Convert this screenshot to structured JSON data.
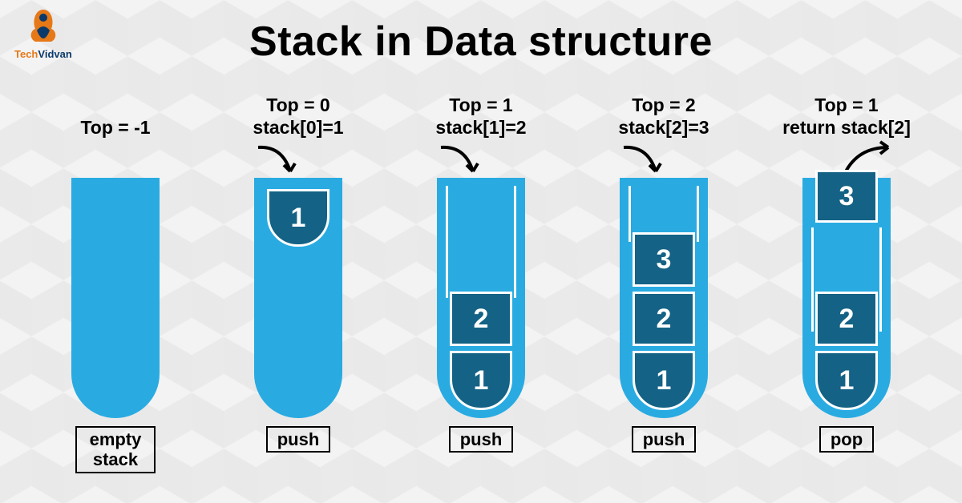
{
  "title": "Stack in Data structure",
  "logo": {
    "brand1": "Tech",
    "brand2": "Vidvan"
  },
  "columns": [
    {
      "top_line1": "Top = -1",
      "top_line2": "",
      "op": "empty\nstack",
      "arrow": "none",
      "items": []
    },
    {
      "top_line1": "Top = 0",
      "top_line2": "stack[0]=1",
      "op": "push",
      "arrow": "in",
      "items": [
        {
          "v": "1",
          "style": "drop"
        }
      ]
    },
    {
      "top_line1": "Top = 1",
      "top_line2": "stack[1]=2",
      "op": "push",
      "arrow": "in",
      "items": [
        {
          "v": "2",
          "style": "slot"
        },
        {
          "v": "1",
          "style": "bottom"
        }
      ]
    },
    {
      "top_line1": "Top = 2",
      "top_line2": "stack[2]=3",
      "op": "push",
      "arrow": "in",
      "items": [
        {
          "v": "3",
          "style": "slot"
        },
        {
          "v": "2",
          "style": "slot"
        },
        {
          "v": "1",
          "style": "bottom"
        }
      ]
    },
    {
      "top_line1": "Top = 1",
      "top_line2": "return stack[2]",
      "op": "pop",
      "arrow": "out",
      "items": [
        {
          "v": "3",
          "style": "pop"
        },
        {
          "v": "2",
          "style": "slot"
        },
        {
          "v": "1",
          "style": "bottom"
        }
      ]
    }
  ]
}
